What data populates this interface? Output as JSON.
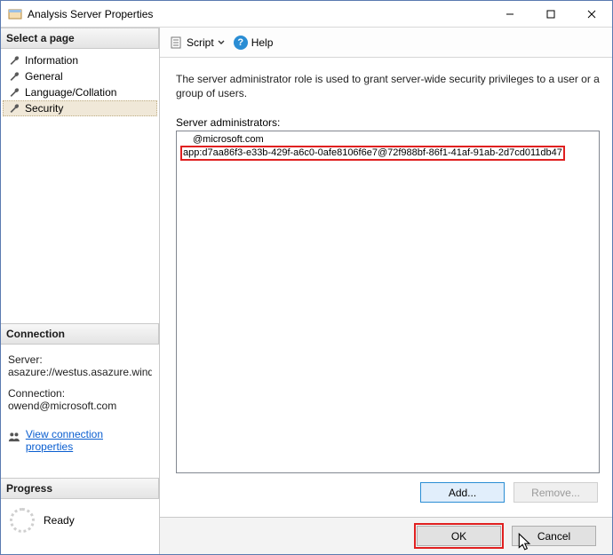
{
  "window": {
    "title": "Analysis Server Properties"
  },
  "sidebar": {
    "header": "Select a page",
    "pages": [
      {
        "label": "Information"
      },
      {
        "label": "General"
      },
      {
        "label": "Language/Collation"
      },
      {
        "label": "Security",
        "selected": true
      }
    ]
  },
  "connection": {
    "header": "Connection",
    "server_label": "Server:",
    "server_value": "asazure://westus.asazure.windows",
    "connection_label": "Connection:",
    "connection_value": "owend@microsoft.com",
    "link_text": "View connection properties"
  },
  "progress": {
    "header": "Progress",
    "status": "Ready"
  },
  "toolbar": {
    "script_label": "Script",
    "help_label": "Help"
  },
  "main": {
    "description": "The server administrator role is used to grant server-wide security privileges to a user or a group of users.",
    "list_label": "Server administrators:",
    "administrators": [
      "@microsoft.com",
      "app:d7aa86f3-e33b-429f-a6c0-0afe8106f6e7@72f988bf-86f1-41af-91ab-2d7cd011db47"
    ],
    "add_label": "Add...",
    "remove_label": "Remove..."
  },
  "footer": {
    "ok_label": "OK",
    "cancel_label": "Cancel"
  }
}
